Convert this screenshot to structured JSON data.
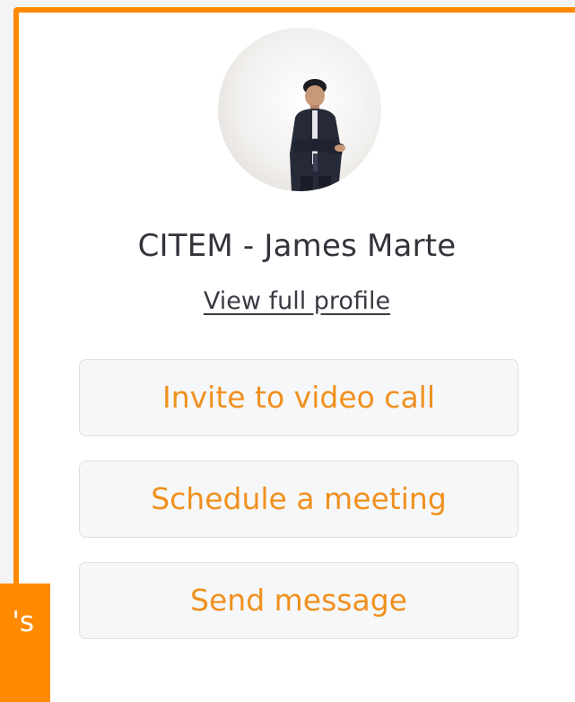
{
  "profile": {
    "name": "CITEM - James Marte",
    "view_profile_label": "View full profile",
    "avatar_icon": "person-photo"
  },
  "actions": [
    {
      "label": "Invite to video call"
    },
    {
      "label": "Schedule a meeting"
    },
    {
      "label": "Send message"
    }
  ],
  "overlay_tag": {
    "text": "'s"
  },
  "colors": {
    "accent": "#ff8a00",
    "button_text": "#f0901e",
    "name_text": "#33333b",
    "button_bg": "#f6f7f9"
  }
}
